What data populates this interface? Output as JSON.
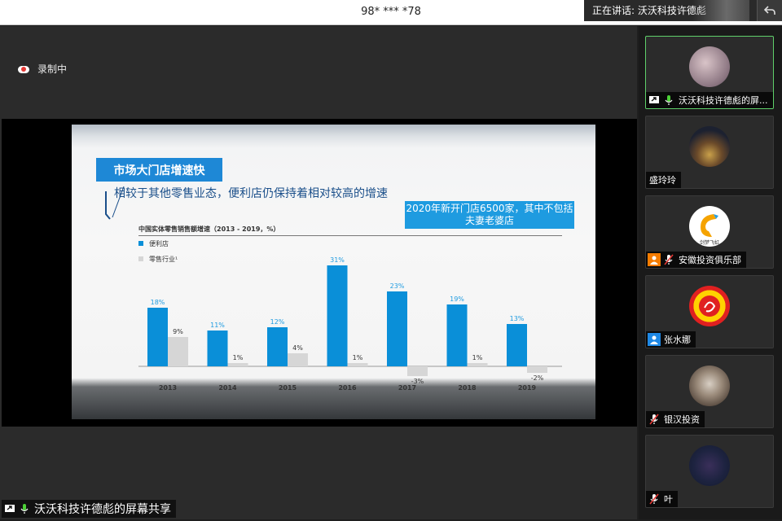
{
  "topbar": {
    "meeting_id": "98* *** *78",
    "speaking_label": "正在讲话: 沃沃科技许德彪"
  },
  "recording": {
    "label": "录制中"
  },
  "share": {
    "owner_label": "沃沃科技许德彪的屏幕共享"
  },
  "slide": {
    "title": "市场大门店增速快",
    "subtitle": "相较于其他零售业态，便利店仍保持着相对较高的增速",
    "callout": "2020年新开门店6500家，其中不包括夫妻老婆店",
    "accent_color": "#1e88d6"
  },
  "chart_data": {
    "type": "bar",
    "title": "中国实体零售销售额增速（2013 - 2019，%）",
    "categories": [
      "2013",
      "2014",
      "2015",
      "2016",
      "2017",
      "2018",
      "2019"
    ],
    "series": [
      {
        "name": "便利店",
        "values": [
          18,
          11,
          12,
          31,
          23,
          19,
          13
        ],
        "color": "#0a8fd8"
      },
      {
        "name": "零售行业¹",
        "values": [
          9,
          1,
          4,
          1,
          -3,
          1,
          -2
        ],
        "color": "#d6d6d6"
      }
    ],
    "data_labels_series1": [
      "18%",
      "11%",
      "12%",
      "31%",
      "23%",
      "19%",
      "13%"
    ],
    "data_labels_series2": [
      "9%",
      "1%",
      "4%",
      "1%",
      "-3%",
      "1%",
      "-2%"
    ],
    "grid": false,
    "legend_position": "top-left"
  },
  "participants": [
    {
      "name": "沃沃科技许德彪的屏...",
      "icons": [
        "screen-share-icon",
        "mic-on-icon"
      ],
      "active": true
    },
    {
      "name": "盛玲玲",
      "icons": [],
      "active": false
    },
    {
      "name": "安徽投资俱乐部",
      "icons": [
        "person-icon",
        "mic-muted-icon"
      ],
      "active": false,
      "avatar_text": "剑梦飞虹"
    },
    {
      "name": "张水娜",
      "icons": [
        "person-icon"
      ],
      "active": false
    },
    {
      "name": "银汉投资",
      "icons": [
        "mic-muted-icon"
      ],
      "active": false
    },
    {
      "name": "叶",
      "icons": [
        "mic-muted-icon"
      ],
      "active": false
    }
  ]
}
